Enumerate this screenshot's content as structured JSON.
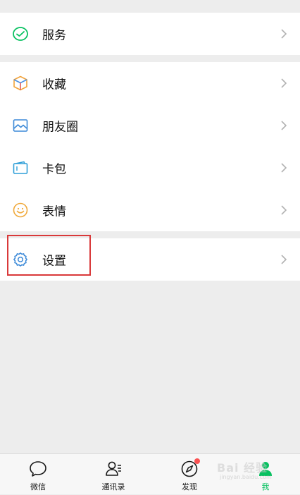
{
  "menu": {
    "groups": [
      {
        "items": [
          {
            "label": "服务",
            "icon": "wechat-pay-icon"
          }
        ]
      },
      {
        "items": [
          {
            "label": "收藏",
            "icon": "favorites-cube-icon"
          },
          {
            "label": "朋友圈",
            "icon": "moments-image-icon"
          },
          {
            "label": "卡包",
            "icon": "card-wallet-icon"
          },
          {
            "label": "表情",
            "icon": "emoji-smile-icon"
          }
        ]
      },
      {
        "items": [
          {
            "label": "设置",
            "icon": "gear-icon"
          }
        ]
      }
    ]
  },
  "tabbar": {
    "tabs": [
      {
        "label": "微信",
        "icon": "chat-bubble-icon",
        "active": false
      },
      {
        "label": "通讯录",
        "icon": "contacts-icon",
        "active": false
      },
      {
        "label": "发现",
        "icon": "compass-icon",
        "active": false,
        "badge_dot": true
      },
      {
        "label": "我",
        "icon": "me-person-icon",
        "active": true
      }
    ]
  },
  "colors": {
    "accent_green": "#07c160",
    "highlight_red": "#d9393a",
    "badge_red": "#fa5151",
    "background": "#ededed"
  },
  "watermark": {
    "text": "Bai 经验",
    "sub": "jingyan.baidu.com"
  }
}
